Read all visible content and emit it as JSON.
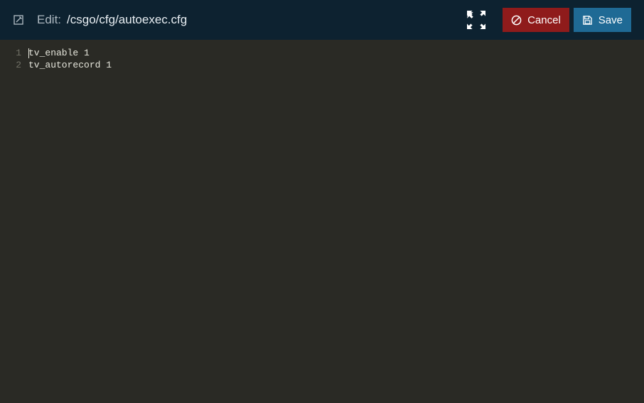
{
  "header": {
    "edit_label": "Edit:",
    "file_path": "/csgo/cfg/autoexec.cfg",
    "cancel_label": "Cancel",
    "save_label": "Save"
  },
  "editor": {
    "lines": [
      {
        "num": "1",
        "text": "tv_enable 1"
      },
      {
        "num": "2",
        "text": "tv_autorecord 1"
      }
    ]
  }
}
